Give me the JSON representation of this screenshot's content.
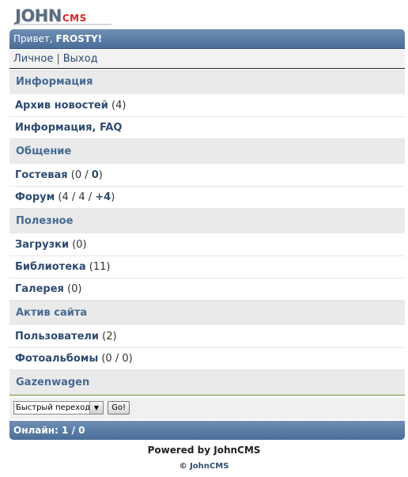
{
  "logo": {
    "john": "JOHN",
    "cms": "CMS"
  },
  "header": {
    "greeting": "Привет, ",
    "username": "FROSTY",
    "excl": "!"
  },
  "menu": {
    "personal": "Личное",
    "separator": "|",
    "logout": "Выход"
  },
  "sections": [
    {
      "title": "Информация"
    },
    {
      "title": "Общение"
    },
    {
      "title": "Полезное"
    },
    {
      "title": "Актив сайта"
    }
  ],
  "items": {
    "news_archive": {
      "label": "Архив новостей",
      "count": "(4)"
    },
    "info_faq": {
      "label": "Информация, FAQ"
    },
    "guestbook": {
      "label": "Гостевая",
      "open": " (0 / ",
      "new": "0",
      "close": ")"
    },
    "forum": {
      "label": "Форум",
      "open": " (4 / 4 / ",
      "new": "+4",
      "close": ")"
    },
    "downloads": {
      "label": "Загрузки",
      "count": "(0)"
    },
    "library": {
      "label": "Библиотека",
      "count": "(11)"
    },
    "gallery": {
      "label": "Галерея",
      "count": "(0)"
    },
    "users": {
      "label": "Пользователи",
      "count": "(2)"
    },
    "photoalbums": {
      "label": "Фотоальбомы",
      "count": "(0 / 0)"
    }
  },
  "gazenwagen": "Gazenwagen",
  "quick_jump": {
    "selected": "Быстрый переход",
    "go": "Go!"
  },
  "online": "Онлайн: 1 / 0",
  "footer": {
    "powered": "Powered by JohnCMS",
    "copyright_symbol": "©",
    "copyright": "JohnCMS"
  }
}
